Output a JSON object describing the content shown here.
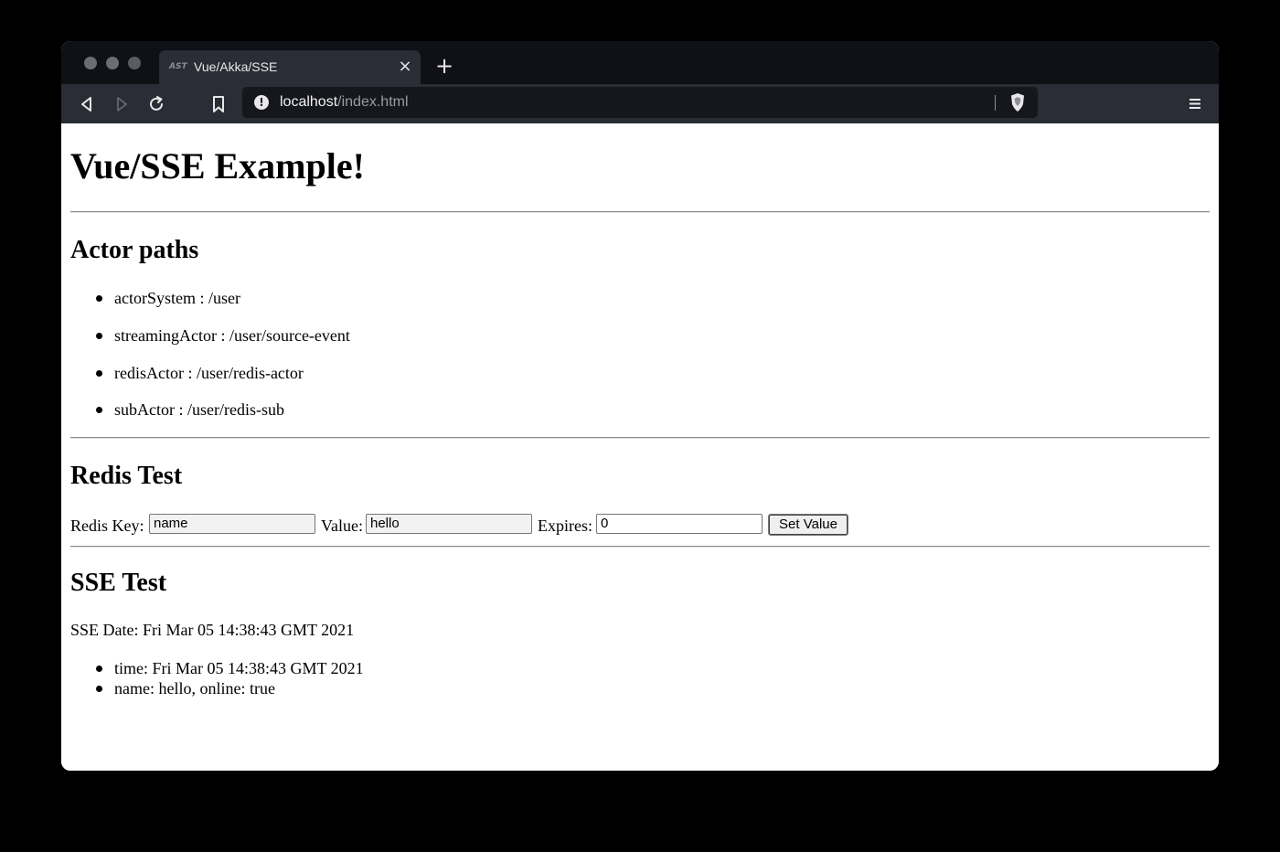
{
  "browser": {
    "tab_favicon": "AST",
    "tab_title": "Vue/Akka/SSE",
    "tab_close": "×",
    "new_tab": "+",
    "url_host": "localhost",
    "url_path": "/index.html",
    "icons": [
      "back-icon",
      "forward-icon",
      "reload-icon",
      "bookmark-icon",
      "info-icon",
      "brave-shield-icon",
      "menu-icon"
    ]
  },
  "page": {
    "title": "Vue/SSE Example!",
    "actor_section": {
      "heading": "Actor paths",
      "items": [
        "actorSystem : /user",
        "streamingActor : /user/source-event",
        "redisActor : /user/redis-actor",
        "subActor : /user/redis-sub"
      ]
    },
    "redis_section": {
      "heading": "Redis Test",
      "key_label": "Redis Key:",
      "key_value": "name",
      "value_label": "Value:",
      "value_value": "hello",
      "expires_label": "Expires:",
      "expires_value": "0",
      "button_label": "Set Value"
    },
    "sse_section": {
      "heading": "SSE Test",
      "date_text": "SSE Date: Fri Mar 05 14:38:43 GMT 2021",
      "items": [
        "time: Fri Mar 05 14:38:43 GMT 2021",
        "name: hello, online: true"
      ]
    }
  }
}
